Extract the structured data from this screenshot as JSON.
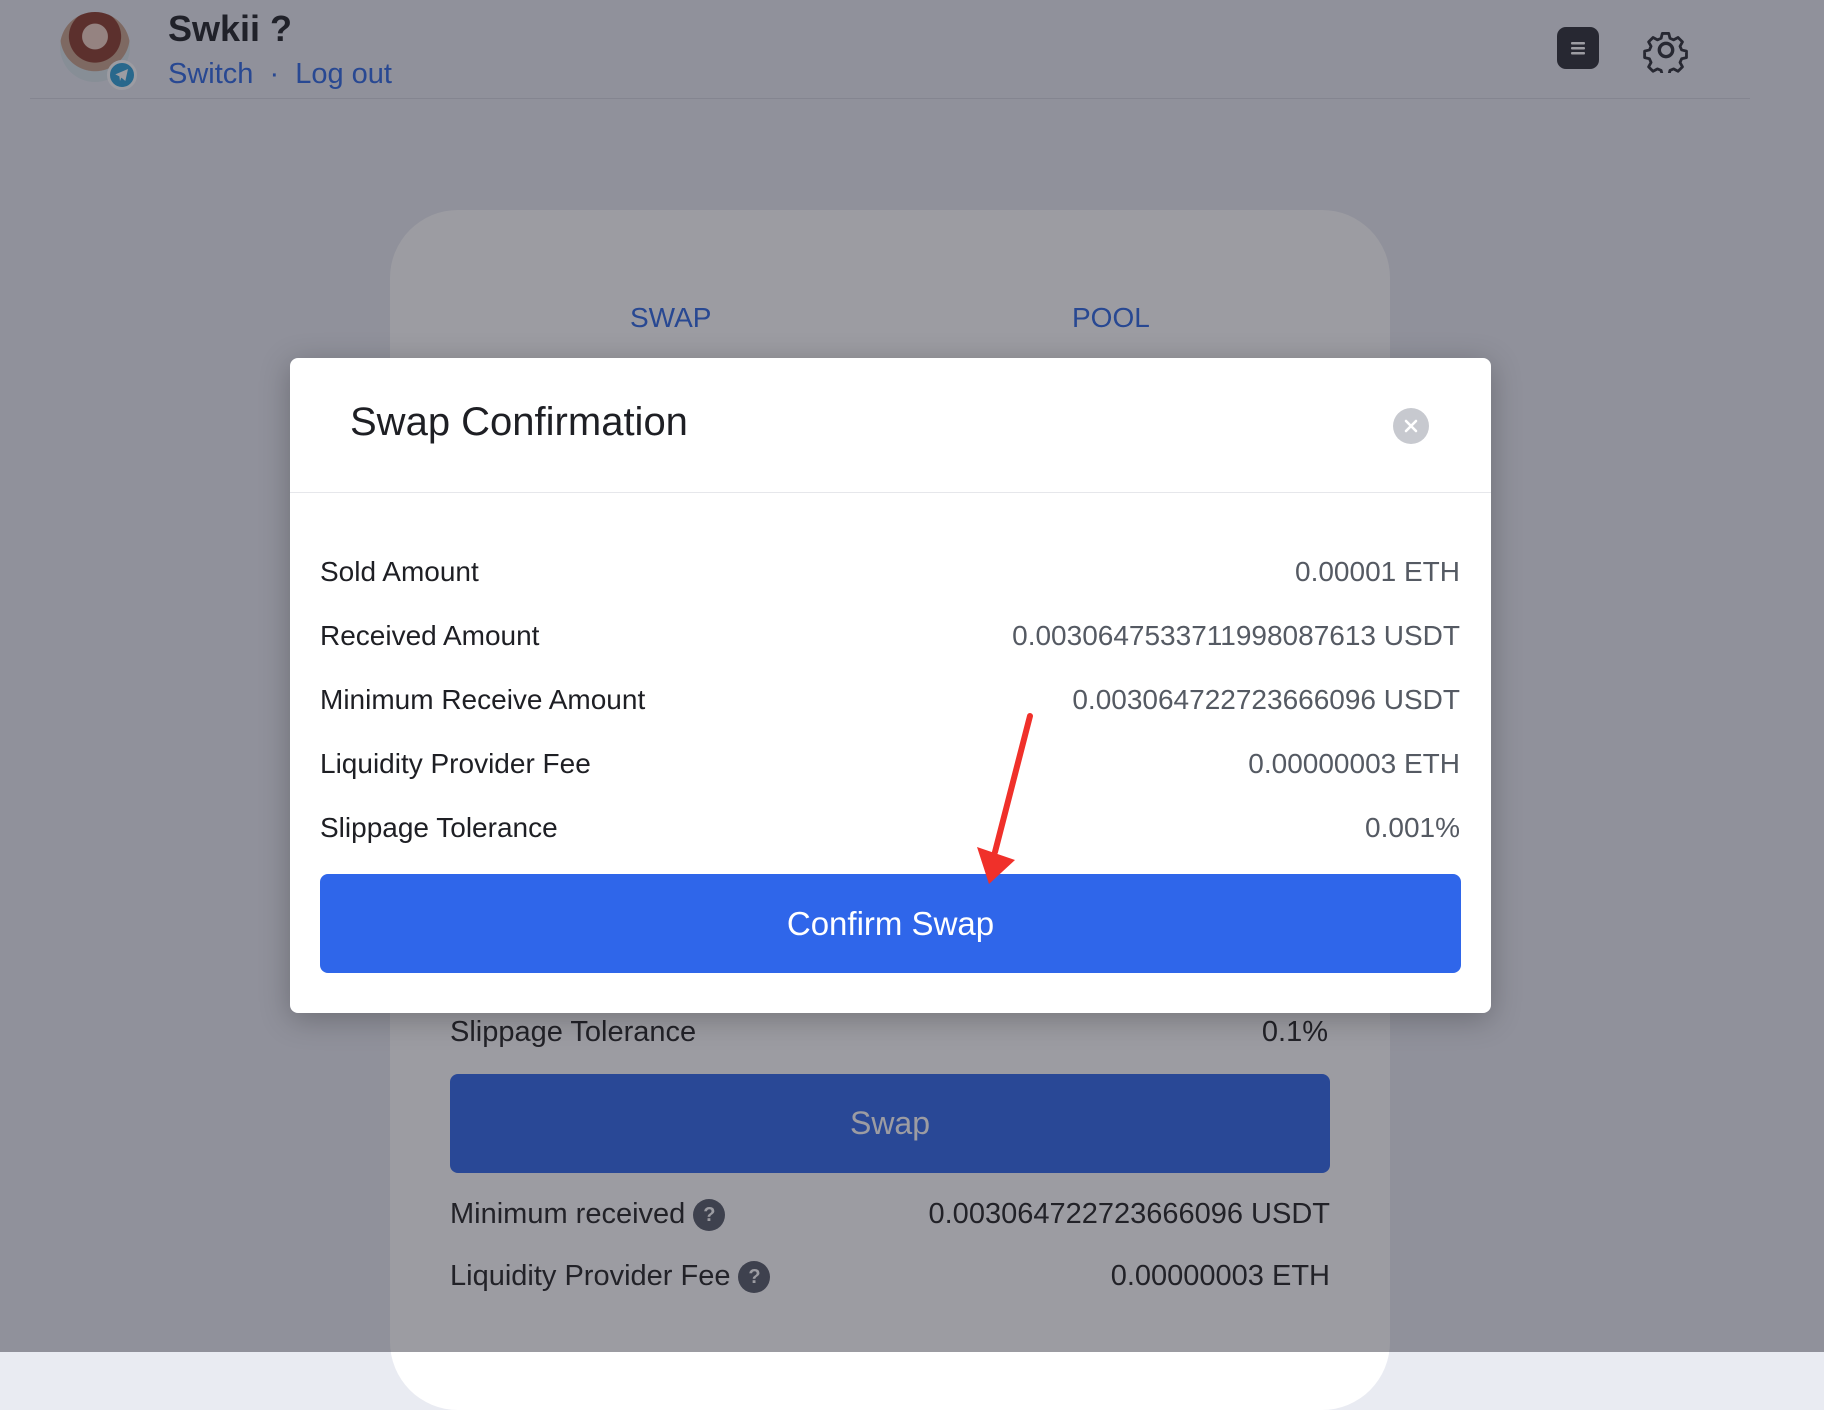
{
  "header": {
    "username": "Swkii ?",
    "switch_label": "Switch",
    "separator": "·",
    "logout_label": "Log out",
    "badge_icon": "telegram-icon",
    "menu_icon": "menu-icon",
    "settings_icon": "gear-icon"
  },
  "tabs": [
    {
      "label": "SWAP"
    },
    {
      "label": "POOL"
    }
  ],
  "background_card": {
    "slippage_label": "Slippage Tolerance",
    "slippage_value": "0.1%",
    "swap_button": "Swap",
    "min_received_label": "Minimum received",
    "min_received_value": "0.003064722723666096 USDT",
    "fee_label": "Liquidity Provider Fee",
    "fee_value": "0.00000003 ETH",
    "help_glyph": "?"
  },
  "modal": {
    "title": "Swap Confirmation",
    "close_icon": "close-icon",
    "rows": [
      {
        "label": "Sold Amount",
        "value": "0.00001 ETH"
      },
      {
        "label": "Received Amount",
        "value": "0.003064753371199808761​3 USDT"
      },
      {
        "label": "Minimum Receive Amount",
        "value": "0.003064722723666096 USDT"
      },
      {
        "label": "Liquidity Provider Fee",
        "value": "0.00000003 ETH"
      },
      {
        "label": "Slippage Tolerance",
        "value": "0.001%"
      }
    ],
    "confirm_button": "Confirm Swap"
  },
  "colors": {
    "accent": "#2f66ea",
    "link": "#2c66e2",
    "annotation_arrow": "#f0302a"
  }
}
